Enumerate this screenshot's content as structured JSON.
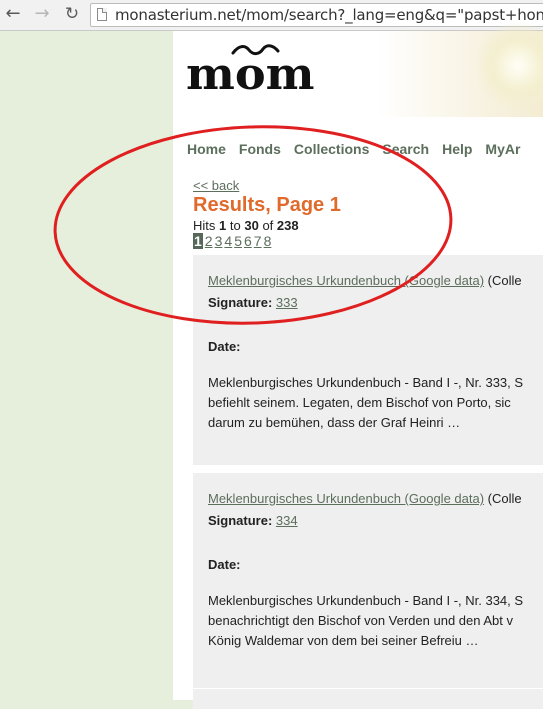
{
  "browser": {
    "url": "monasterium.net/mom/search?_lang=eng&q=\"papst+honor"
  },
  "site": {
    "logo_text": "mom",
    "menu": [
      "Home",
      "Fonds",
      "Collections",
      "Search",
      "Help",
      "MyAr"
    ]
  },
  "results": {
    "back_label": "<< back",
    "title": "Results, Page 1",
    "hits_prefix": "Hits",
    "hits_from": "1",
    "hits_to_word": "to",
    "hits_to": "30",
    "hits_of_word": "of",
    "hits_total": "238",
    "pages": [
      "1",
      "2",
      "3",
      "4",
      "5",
      "6",
      "7",
      "8"
    ],
    "current_page": "1"
  },
  "entries": [
    {
      "title": "Meklenburgisches Urkundenbuch (Google data)",
      "suffix": "(Colle",
      "signature_label": "Signature:",
      "signature": "333",
      "date_label": "Date:",
      "excerpt": [
        "Meklenburgisches Urkundenbuch - Band I -, Nr. 333, S",
        "befiehlt seinem. Legaten, dem Bischof von Porto, sic",
        "darum zu bemühen, dass der Graf Heinri …"
      ]
    },
    {
      "title": "Meklenburgisches Urkundenbuch (Google data)",
      "suffix": "(Colle",
      "signature_label": "Signature:",
      "signature": "334",
      "date_label": "Date:",
      "excerpt": [
        "Meklenburgisches Urkundenbuch - Band I -, Nr. 334, S",
        "benachrichtigt den Bischof von Verden und den Abt v",
        "König Waldemar von dem bei seiner Befreiu …"
      ]
    }
  ],
  "annotation": {
    "oval_color": "#e02020"
  },
  "colors": {
    "accent": "#e06a2c",
    "link": "#5c6e5c",
    "sidebar": "#e6efdb"
  }
}
